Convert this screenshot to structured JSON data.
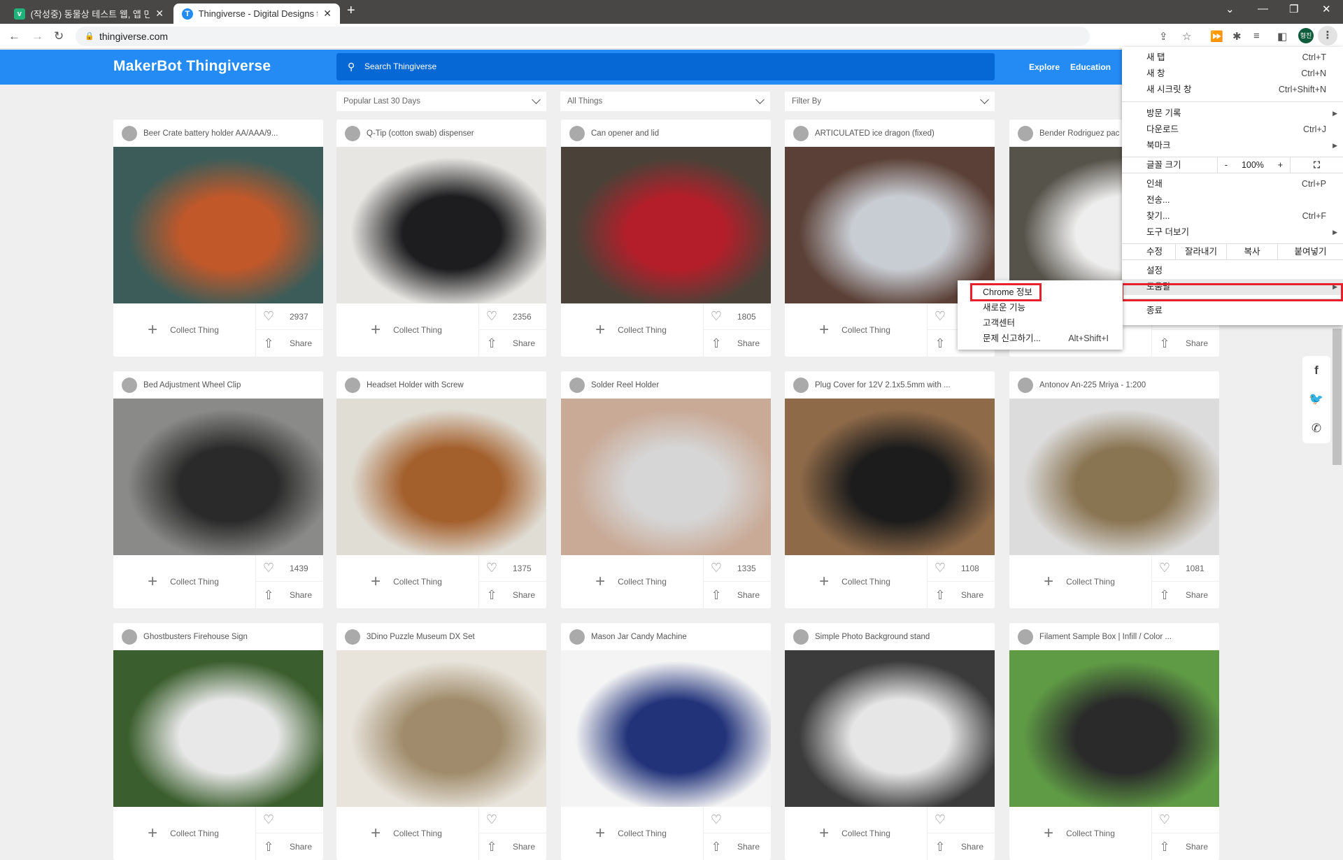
{
  "browser": {
    "tabs": [
      {
        "title": "(작성중) 동물상 테스트 웹, 앱 만",
        "favicon": "v",
        "favicon_color": "#20b27a",
        "active": false
      },
      {
        "title": "Thingiverse - Digital Designs for",
        "favicon": "T",
        "favicon_color": "#248bf5",
        "active": true
      }
    ],
    "url": "thingiverse.com",
    "profile": "형진"
  },
  "site": {
    "logo": "MakerBot Thingiverse",
    "search_placeholder": "Search Thingiverse",
    "nav": [
      "Explore",
      "Education"
    ],
    "filters": [
      "Popular Last 30 Days",
      "All Things",
      "Filter By"
    ]
  },
  "labels": {
    "collect": "Collect Thing",
    "share": "Share"
  },
  "things": [
    {
      "title": "Beer Crate battery holder AA/AAA/9...",
      "likes": "2937",
      "img": [
        "#3c5c59",
        "#c0582a"
      ]
    },
    {
      "title": "Q-Tip (cotton swab) dispenser",
      "likes": "2356",
      "img": [
        "#e8e6e2",
        "#1d1d1f"
      ]
    },
    {
      "title": "Can opener and lid",
      "likes": "1805",
      "img": [
        "#4a4238",
        "#b41e2a"
      ]
    },
    {
      "title": "ARTICULATED ice dragon (fixed)",
      "likes": "",
      "img": [
        "#5a4036",
        "#c8ccd3"
      ]
    },
    {
      "title": "Bender Rodriguez pac",
      "likes": "",
      "img": [
        "#56534a",
        "#eeeeee"
      ]
    },
    {
      "title": "Bed Adjustment Wheel Clip",
      "likes": "1439",
      "img": [
        "#8a8a88",
        "#2a2a2a"
      ]
    },
    {
      "title": "Headset Holder with Screw",
      "likes": "1375",
      "img": [
        "#e0ddd5",
        "#a35f2c"
      ]
    },
    {
      "title": "Solder Reel Holder",
      "likes": "1335",
      "img": [
        "#c9aa97",
        "#d6d6d6"
      ]
    },
    {
      "title": "Plug Cover for 12V 2.1x5.5mm with ...",
      "likes": "1108",
      "img": [
        "#8e6a49",
        "#1c1c1c"
      ]
    },
    {
      "title": "Antonov An-225 Mriya - 1:200",
      "likes": "1081",
      "img": [
        "#dcdcdc",
        "#8a7553"
      ]
    },
    {
      "title": "Ghostbusters Firehouse Sign",
      "likes": "",
      "img": [
        "#3b5e2e",
        "#e8e8e8"
      ]
    },
    {
      "title": "3Dino Puzzle Museum DX Set",
      "likes": "",
      "img": [
        "#e8e4dc",
        "#a08c6c"
      ]
    },
    {
      "title": "Mason Jar Candy Machine",
      "likes": "",
      "img": [
        "#f4f4f4",
        "#22337a"
      ]
    },
    {
      "title": "Simple Photo Background stand",
      "likes": "",
      "img": [
        "#3b3b3b",
        "#e6e6e6"
      ]
    },
    {
      "title": "Filament Sample Box | Infill / Color ...",
      "likes": "",
      "img": [
        "#5f9a45",
        "#2a2a2a"
      ]
    }
  ],
  "menu": {
    "items": [
      {
        "label": "새 탭",
        "shortcut": "Ctrl+T"
      },
      {
        "label": "새 창",
        "shortcut": "Ctrl+N"
      },
      {
        "label": "새 시크릿 창",
        "shortcut": "Ctrl+Shift+N"
      },
      {
        "label": "방문 기록",
        "shortcut": ""
      },
      {
        "label": "다운로드",
        "shortcut": "Ctrl+J"
      },
      {
        "label": "북마크",
        "shortcut": ""
      },
      {
        "label": "인쇄",
        "shortcut": "Ctrl+P"
      },
      {
        "label": "전송...",
        "shortcut": ""
      },
      {
        "label": "찾기...",
        "shortcut": "Ctrl+F"
      },
      {
        "label": "도구 더보기",
        "shortcut": ""
      },
      {
        "label": "설정",
        "shortcut": ""
      },
      {
        "label": "도움말",
        "shortcut": ""
      },
      {
        "label": "종료",
        "shortcut": ""
      }
    ],
    "zoom": {
      "label": "글꼴 크기",
      "minus": "-",
      "value": "100%",
      "plus": "+"
    },
    "edit": {
      "label": "수정",
      "cut": "잘라내기",
      "copy": "복사",
      "paste": "붙여넣기"
    }
  },
  "help_submenu": [
    {
      "label": "Chrome 정보",
      "shortcut": ""
    },
    {
      "label": "새로운 기능",
      "shortcut": ""
    },
    {
      "label": "고객센터",
      "shortcut": ""
    },
    {
      "label": "문제 신고하기...",
      "shortcut": "Alt+Shift+I"
    }
  ]
}
